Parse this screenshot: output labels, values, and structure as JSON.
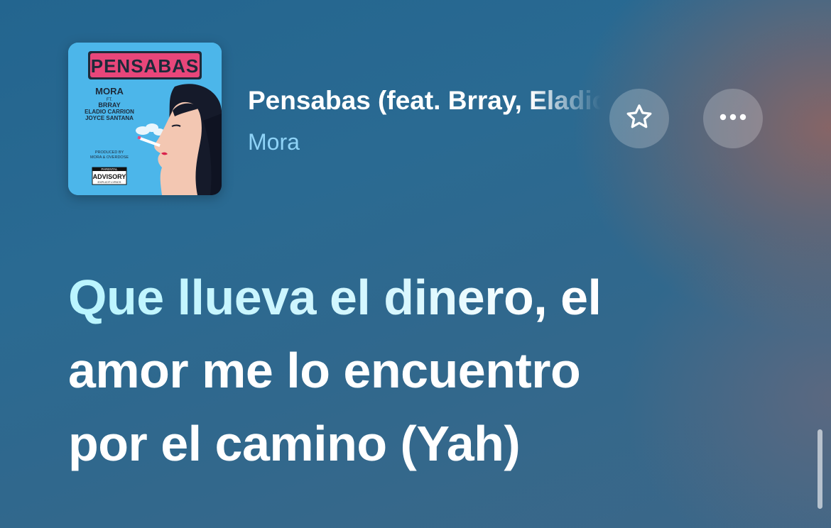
{
  "now_playing": {
    "title": "Pensabas (feat. Brray, Eladio Carrión & Joyce Santana)",
    "artist": "Mora",
    "artwork": {
      "title_text": "PENSABAS",
      "artist_text": "MORA",
      "feat_lines": [
        "FT.",
        "BRRAY",
        "ELADIO CARRION",
        "JOYCE SANTANA"
      ],
      "produced_text": [
        "PRODUCED BY",
        "MORA & OVERDOSE"
      ],
      "advisory_text": [
        "PARENTAL",
        "ADVISORY",
        "EXPLICIT LYRICS"
      ],
      "background_color": "#4cb6ea",
      "title_color": "#e8467a"
    }
  },
  "actions": {
    "favorite_icon": "star-outline",
    "more_icon": "ellipsis"
  },
  "lyrics": {
    "lines": [
      {
        "highlighted": "Que llueva el dinero,",
        "rest": " el"
      },
      {
        "highlighted": "",
        "rest": "amor me lo encuentro"
      },
      {
        "highlighted": "",
        "rest": "por el camino (Yah)"
      }
    ]
  },
  "colors": {
    "background_top": "#23658f",
    "background_warm": "#966460",
    "artist_text": "#8fd3f7",
    "lyric_highlight": "#b9f5ff",
    "lyric_text": "#ffffff"
  }
}
